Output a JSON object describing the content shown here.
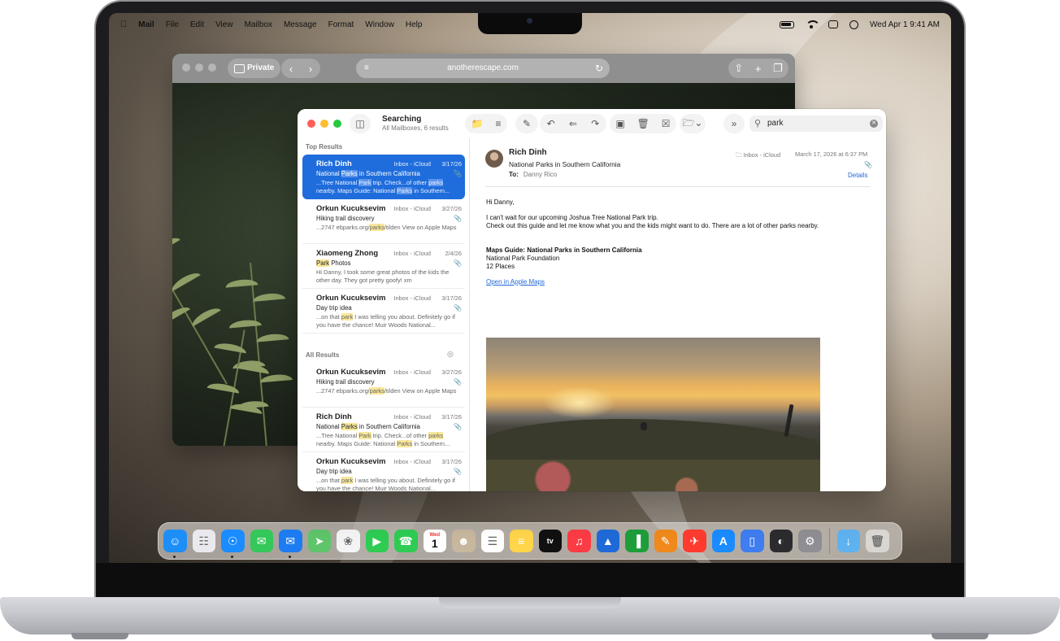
{
  "menubar": {
    "apple": "",
    "items": [
      "Mail",
      "File",
      "Edit",
      "View",
      "Mailbox",
      "Message",
      "Format",
      "Window",
      "Help"
    ],
    "datetime": "Wed Apr 1  9:41 AM"
  },
  "safari": {
    "private_label": "Private",
    "url": "anotherescape.com"
  },
  "mail": {
    "title": "Searching",
    "subtitle": "All Mailboxes, 6 results",
    "search_value": "park",
    "sections": {
      "top": "Top Results",
      "all": "All Results"
    },
    "top_results": [
      {
        "from": "Rich Dinh",
        "mailbox": "Inbox - iCloud",
        "date": "3/17/26",
        "subject_pre": "National ",
        "subject_hl": "Parks",
        "subject_post": " in Southern California",
        "preview_html": "...Tree National <mark>Park</mark> trip. Check...of other <mark>parks</mark> nearby. Maps Guide: National <mark>Parks</mark> in Southern...",
        "selected": true
      },
      {
        "from": "Orkun Kucuksevim",
        "mailbox": "Inbox - iCloud",
        "date": "3/27/26",
        "subject_pre": "Hiking trail discovery",
        "subject_hl": "",
        "subject_post": "",
        "preview_html": "...2747 ebparks.org/<mark>parks</mark>/tilden View on Apple Maps",
        "selected": false
      },
      {
        "from": "Xiaomeng Zhong",
        "mailbox": "Inbox - iCloud",
        "date": "2/4/26",
        "subject_pre": "",
        "subject_hl": "Park",
        "subject_post": " Photos",
        "preview_html": "Hi Danny, I took some great photos of the kids the other day. They got pretty goofy! xm",
        "selected": false
      },
      {
        "from": "Orkun Kucuksevim",
        "mailbox": "Inbox - iCloud",
        "date": "3/17/26",
        "subject_pre": "Day trip idea",
        "subject_hl": "",
        "subject_post": "",
        "preview_html": "...on that <mark>park</mark> I was telling you about. Definitely go if you have the chance! Muir Woods National...",
        "selected": false
      }
    ],
    "all_results": [
      {
        "from": "Orkun Kucuksevim",
        "mailbox": "Inbox - iCloud",
        "date": "3/27/26",
        "subject_pre": "Hiking trail discovery",
        "subject_hl": "",
        "subject_post": "",
        "preview_html": "...2747 ebparks.org/<mark>parks</mark>/tilden View on Apple Maps",
        "selected": false
      },
      {
        "from": "Rich Dinh",
        "mailbox": "Inbox - iCloud",
        "date": "3/17/26",
        "subject_pre": "National ",
        "subject_hl": "Parks",
        "subject_post": " in Southern California",
        "preview_html": "...Tree National <mark>Park</mark> trip. Check...of other <mark>parks</mark> nearby. Maps Guide: National <mark>Parks</mark> in Southern...",
        "selected": false
      },
      {
        "from": "Orkun Kucuksevim",
        "mailbox": "Inbox - iCloud",
        "date": "3/17/26",
        "subject_pre": "Day trip idea",
        "subject_hl": "",
        "subject_post": "",
        "preview_html": "...on that <mark>park</mark> I was telling you about. Definitely go if you have the chance! Muir Woods National...",
        "selected": false
      }
    ],
    "reader": {
      "from": "Rich Dinh",
      "subject": "National Parks in Southern California",
      "to_label": "To:",
      "to": "Danny Rico",
      "mailbox": "Inbox - iCloud",
      "date": "March 17, 2026 at 6:37 PM",
      "details": "Details",
      "greeting": "Hi Danny,",
      "line1": "I can't wait for our upcoming Joshua Tree National Park trip.",
      "line2": "Check out this guide and let me know what you and the kids might want to do. There are a lot of other parks nearby.",
      "guide_title": "Maps Guide: National Parks in Southern California",
      "guide_org": "National Park Foundation",
      "guide_places": "12 Places",
      "link": "Open in Apple Maps"
    }
  },
  "dock": {
    "apps": [
      {
        "name": "finder",
        "color": "#1e8ef7",
        "running": true
      },
      {
        "name": "launchpad",
        "color": "#e9e9ee",
        "running": false
      },
      {
        "name": "safari",
        "color": "#1a8cff",
        "running": true
      },
      {
        "name": "messages",
        "color": "#34c759",
        "running": false
      },
      {
        "name": "mail",
        "color": "#1e7cf2",
        "running": true
      },
      {
        "name": "maps",
        "color": "#5fc46a",
        "running": false
      },
      {
        "name": "photos",
        "color": "#f4f4f4",
        "running": false
      },
      {
        "name": "facetime",
        "color": "#2ecc53",
        "running": false
      },
      {
        "name": "phone",
        "color": "#2ecc53",
        "running": false
      },
      {
        "name": "calendar",
        "color": "#ffffff",
        "running": false
      },
      {
        "name": "contacts",
        "color": "#c8b79f",
        "running": false
      },
      {
        "name": "reminders",
        "color": "#ffffff",
        "running": false
      },
      {
        "name": "notes",
        "color": "#ffd54a",
        "running": false
      },
      {
        "name": "tv",
        "color": "#111111",
        "running": false
      },
      {
        "name": "music",
        "color": "#fc3c44",
        "running": false
      },
      {
        "name": "keynote",
        "color": "#1f6ad8",
        "running": false
      },
      {
        "name": "numbers",
        "color": "#1e9e3a",
        "running": false
      },
      {
        "name": "pages",
        "color": "#f08a1c",
        "running": false
      },
      {
        "name": "games",
        "color": "#ff3b30",
        "running": false
      },
      {
        "name": "app-store",
        "color": "#1a8cff",
        "running": false
      },
      {
        "name": "iphone-mirroring",
        "color": "#3f7df0",
        "running": false
      },
      {
        "name": "vision",
        "color": "#2c2c2e",
        "running": false
      },
      {
        "name": "system-settings",
        "color": "#8e8e93",
        "running": false
      }
    ],
    "calendar_month": "Wed",
    "calendar_day": "1",
    "tv_label": "tv"
  }
}
